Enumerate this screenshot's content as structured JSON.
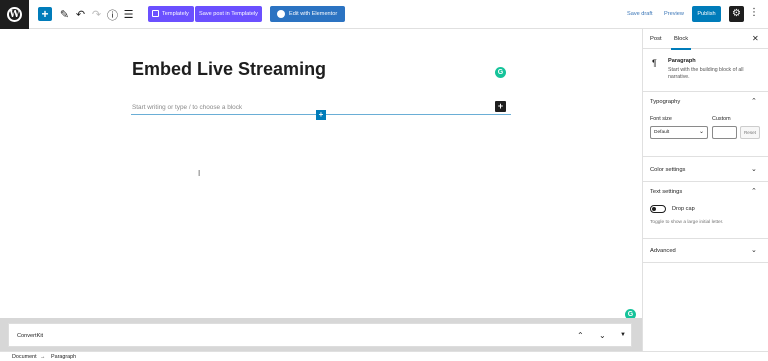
{
  "toolbar": {
    "templately_label": "Templately",
    "save_templately_label": "Save post in Templately",
    "elementor_label": "Edit with Elementor",
    "save_draft_label": "Save draft",
    "preview_label": "Preview",
    "publish_label": "Publish"
  },
  "editor": {
    "title": "Embed Live Streaming",
    "block_placeholder": "Start writing or type / to choose a block"
  },
  "metabox": {
    "title": "ConvertKit"
  },
  "footer": {
    "crumb_root": "Document",
    "separator": "→",
    "crumb_current": "Paragraph"
  },
  "sidebar": {
    "tab_post": "Post",
    "tab_block": "Block",
    "block_name": "Paragraph",
    "block_description": "Start with the building block of all narrative.",
    "typography_title": "Typography",
    "font_size_label": "Font size",
    "custom_label": "Custom",
    "font_size_value": "Default",
    "reset_label": "Reset",
    "color_settings_title": "Color settings",
    "text_settings_title": "Text settings",
    "drop_cap_label": "Drop cap",
    "drop_cap_help": "Toggle to show a large initial letter.",
    "advanced_title": "Advanced"
  },
  "colors": {
    "accent": "#007cba",
    "templately": "#6b50ff",
    "elementor": "#2b73c2",
    "grammarly": "#15c39a"
  }
}
